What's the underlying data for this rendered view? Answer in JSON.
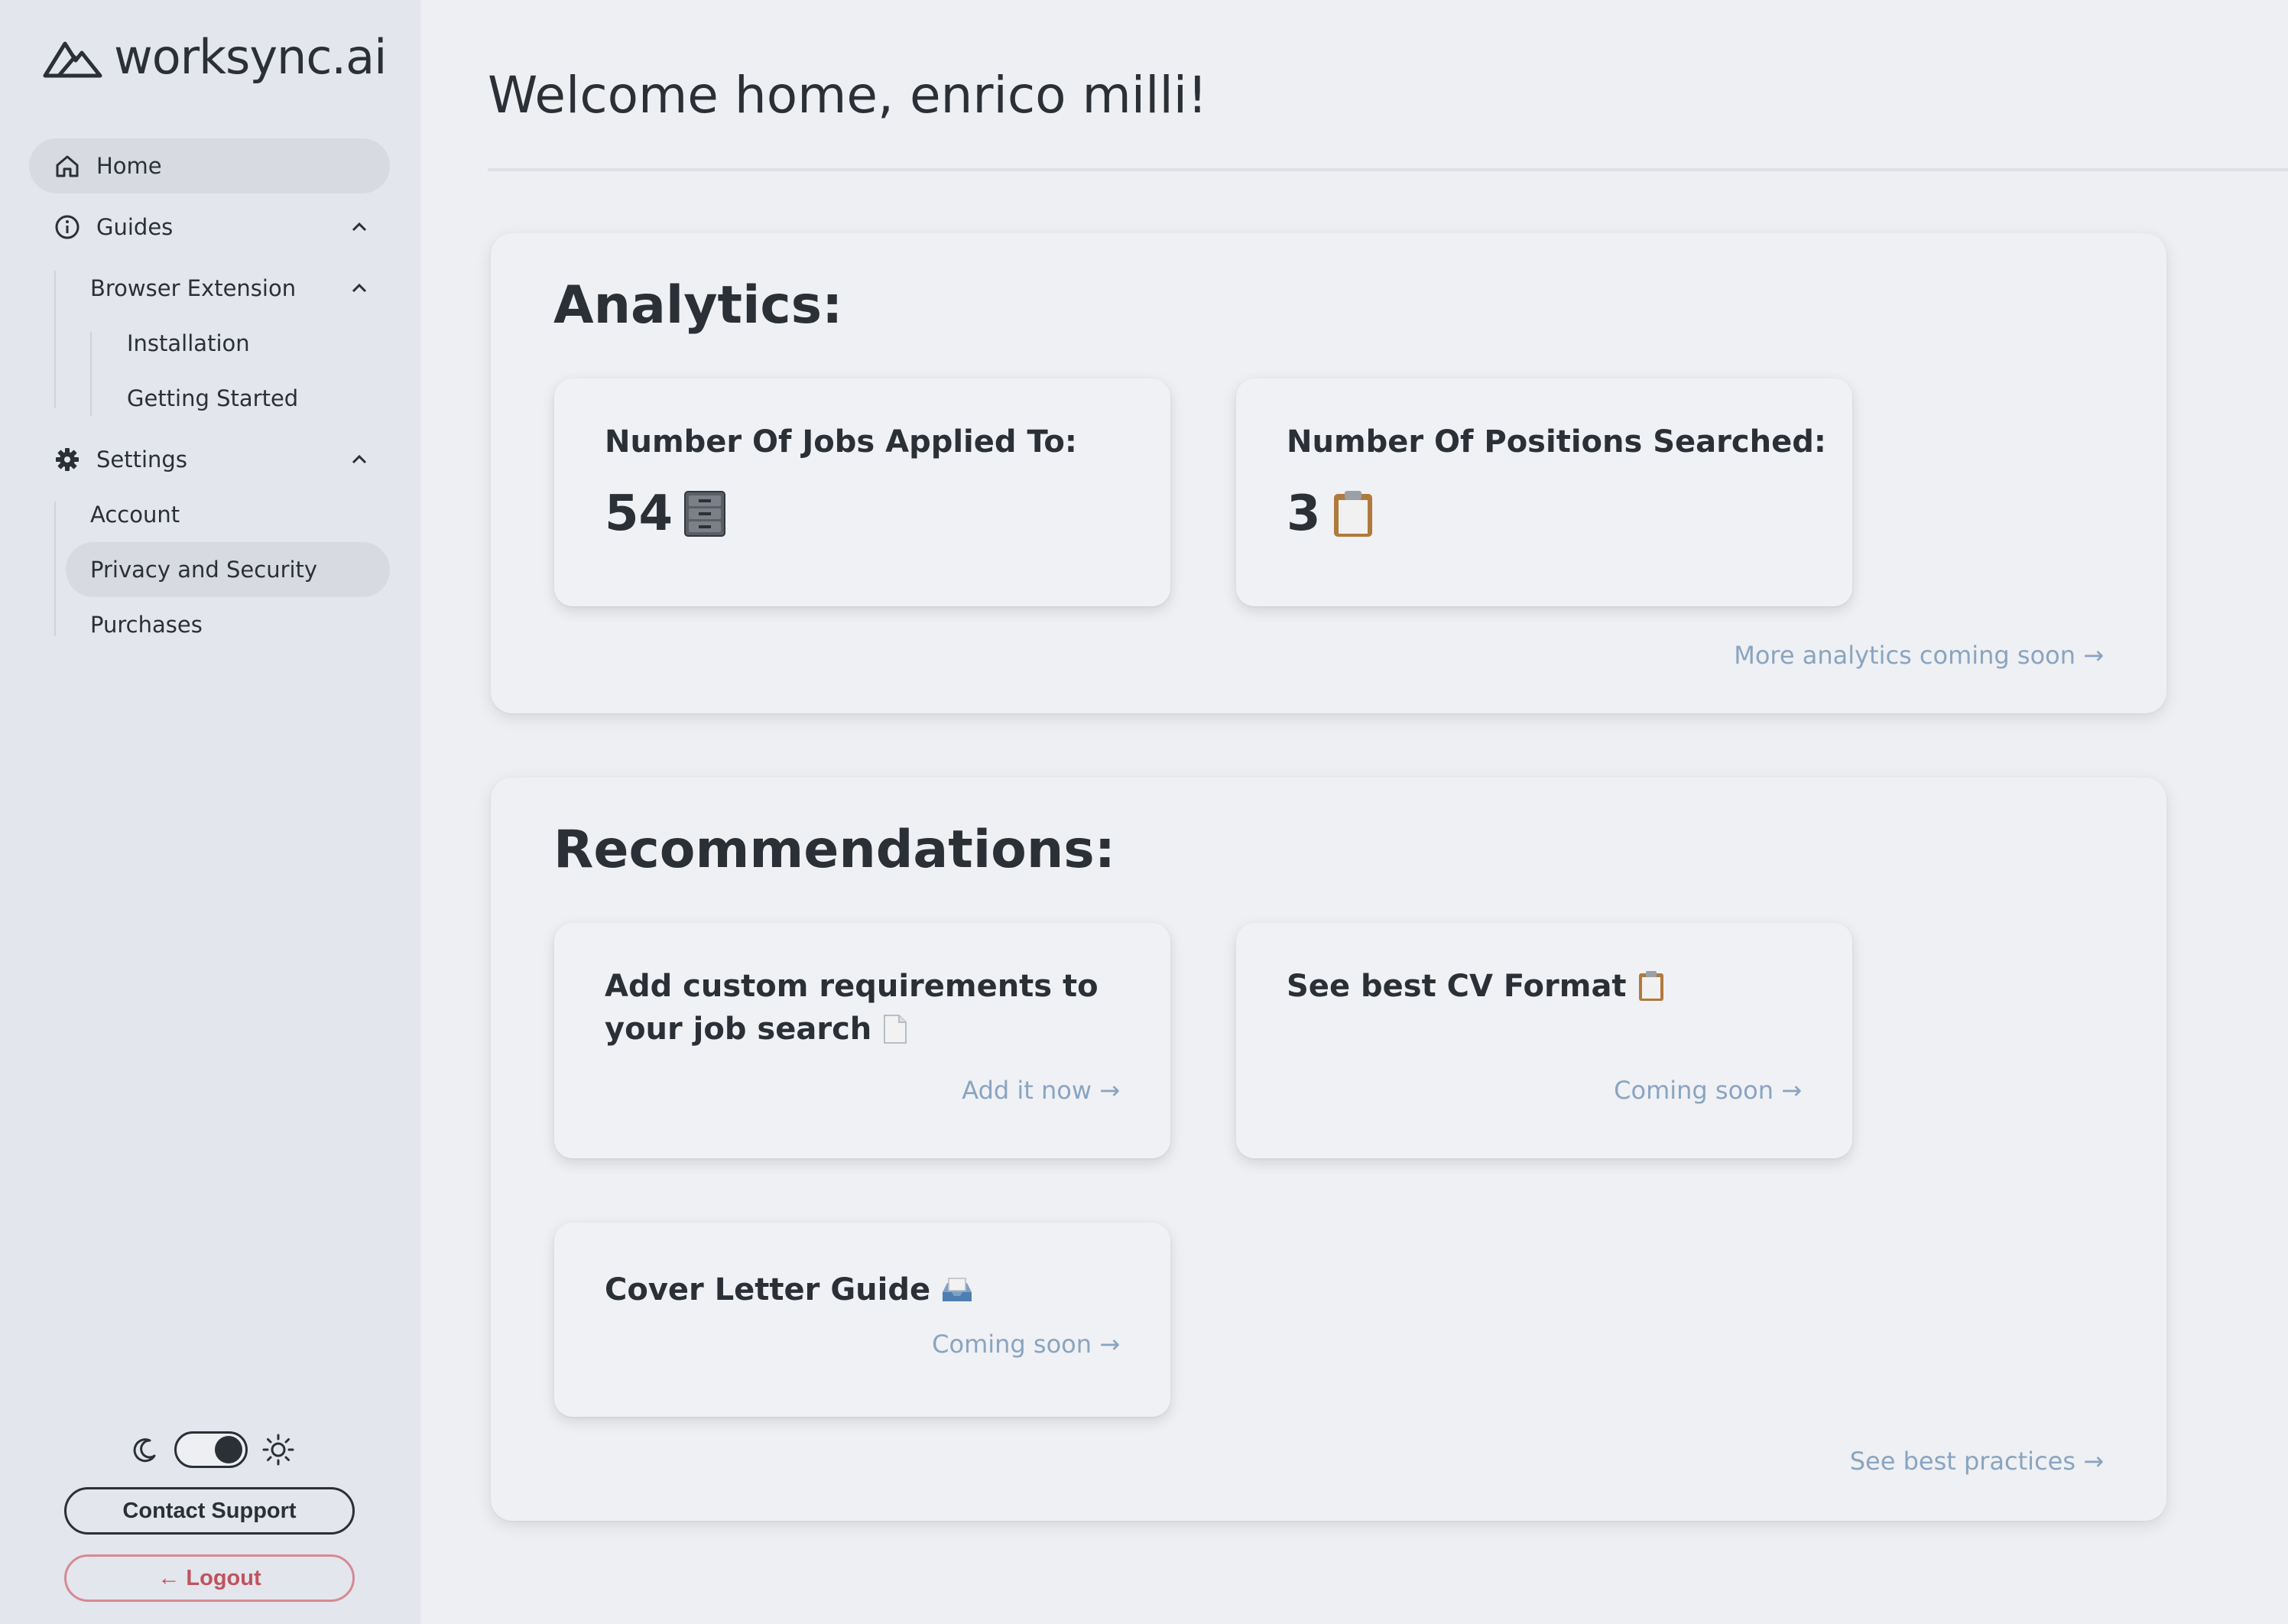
{
  "app": {
    "brand": "worksync.ai"
  },
  "sidebar": {
    "home": "Home",
    "guides": "Guides",
    "browser_extension": "Browser Extension",
    "installation": "Installation",
    "getting_started": "Getting Started",
    "settings": "Settings",
    "account": "Account",
    "privacy_security": "Privacy and Security",
    "purchases": "Purchases",
    "contact_support": "Contact Support",
    "logout": "← Logout"
  },
  "main": {
    "welcome": "Welcome home, enrico milli!",
    "analytics": {
      "title": "Analytics:",
      "jobs_label": "Number Of Jobs Applied To:",
      "jobs_value": "54",
      "positions_label": "Number Of Positions Searched:",
      "positions_value": "3",
      "more_link": "More analytics coming soon →"
    },
    "recommendations": {
      "title": "Recommendations:",
      "custom_title_line1": "Add custom requirements to",
      "custom_title_line2": "your job search",
      "custom_link": "Add it now →",
      "cv_title": "See best CV Format",
      "cv_link": "Coming soon →",
      "cover_title": "Cover Letter Guide",
      "cover_link": "Coming soon →",
      "best_practices_link": "See best practices →"
    }
  },
  "colors": {
    "sidebar_bg": "#e3e6ec",
    "main_bg": "#edeff3",
    "link": "#8aa4c0",
    "logout": "#c0525f"
  }
}
